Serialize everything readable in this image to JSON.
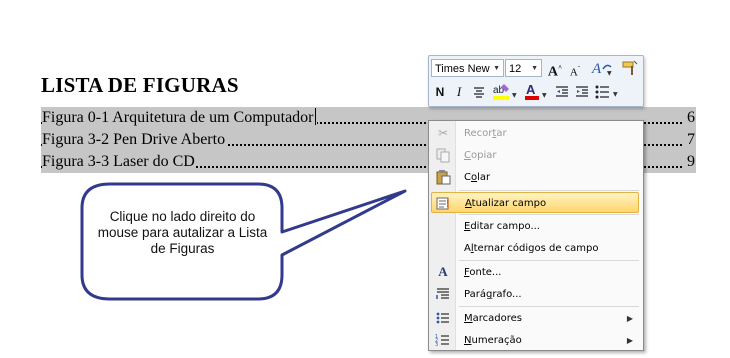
{
  "heading": "LISTA DE FIGURAS",
  "toc": [
    {
      "text": "Figura 0-1 Arquitetura de um Computador",
      "page": "6"
    },
    {
      "text": "Figura 3-2 Pen Drive Aberto",
      "page": "7"
    },
    {
      "text": "Figura 3-3 Laser do CD",
      "page": "9"
    }
  ],
  "mini_toolbar": {
    "font_name": "Times New",
    "font_size": "12",
    "grow_font": "A",
    "shrink_font": "A",
    "bold": "N",
    "italic": "I"
  },
  "context_menu": {
    "items": [
      {
        "label": "Recortar",
        "accel": "t",
        "icon": "scissors-icon",
        "enabled": false
      },
      {
        "label": "Copiar",
        "accel": "C",
        "icon": "copy-icon",
        "enabled": false
      },
      {
        "label": "Colar",
        "accel": "o",
        "icon": "paste-icon",
        "enabled": true
      },
      {
        "label": "Atualizar campo",
        "accel": "A",
        "icon": "update-field-icon",
        "enabled": true,
        "highlighted": true
      },
      {
        "label": "Editar campo...",
        "accel": "E",
        "icon": "",
        "enabled": true
      },
      {
        "label": "Alternar códigos de campo",
        "accel": "l",
        "icon": "",
        "enabled": true
      },
      {
        "label": "Fonte...",
        "accel": "F",
        "icon": "font-icon",
        "enabled": true
      },
      {
        "label": "Parágrafo...",
        "accel": "g",
        "icon": "paragraph-icon",
        "enabled": true
      },
      {
        "label": "Marcadores",
        "accel": "M",
        "icon": "bullets-icon",
        "enabled": true,
        "submenu": true
      },
      {
        "label": "Numeração",
        "accel": "N",
        "icon": "numbering-icon",
        "enabled": true,
        "submenu": true
      }
    ]
  },
  "callout": {
    "text": "Clique no lado direito do mouse para autalizar a Lista de Figuras"
  },
  "colors": {
    "selection": "#c6c6c6",
    "highlight": "#ffd66b",
    "callout_border": "#323a8c",
    "font_color_red": "#e00000",
    "highlighter_yellow": "#ffff00"
  }
}
